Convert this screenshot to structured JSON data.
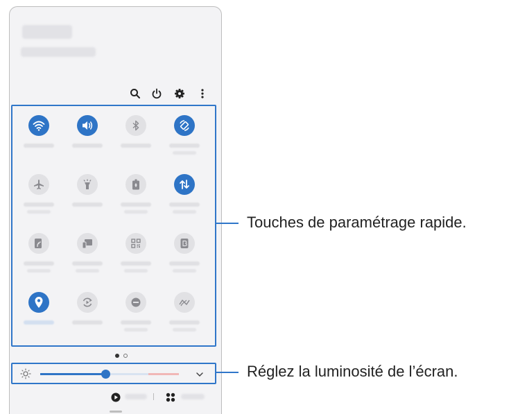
{
  "colors": {
    "accent": "#2e74c6",
    "tile_off": "#e1e1e4",
    "callout": "#2f76c9"
  },
  "toolbar": {
    "icons": [
      "search-icon",
      "power-icon",
      "gear-icon",
      "more-vertical-icon"
    ]
  },
  "quick_settings": {
    "tiles": [
      {
        "icon": "wifi-icon",
        "on": true
      },
      {
        "icon": "sound-icon",
        "on": true
      },
      {
        "icon": "bluetooth-icon",
        "on": false
      },
      {
        "icon": "auto-rotate-icon",
        "on": true
      },
      {
        "icon": "airplane-icon",
        "on": false
      },
      {
        "icon": "flashlight-icon",
        "on": false
      },
      {
        "icon": "power-saving-icon",
        "on": false
      },
      {
        "icon": "mobile-data-icon",
        "on": true
      },
      {
        "icon": "wireless-powershare-icon",
        "on": false
      },
      {
        "icon": "smart-view-icon",
        "on": false
      },
      {
        "icon": "qr-scanner-icon",
        "on": false
      },
      {
        "icon": "bixby-routines-icon",
        "on": false
      },
      {
        "icon": "location-icon",
        "on": true
      },
      {
        "icon": "sync-icon",
        "on": false
      },
      {
        "icon": "do-not-disturb-icon",
        "on": false
      },
      {
        "icon": "nfc-icon",
        "on": false
      }
    ],
    "page_indicator": {
      "current": 1,
      "total": 2
    }
  },
  "brightness": {
    "level": 0.47
  },
  "callouts": {
    "quick_settings": "Touches de paramétrage rapide.",
    "brightness": "Réglez la luminosité de l’écran."
  }
}
